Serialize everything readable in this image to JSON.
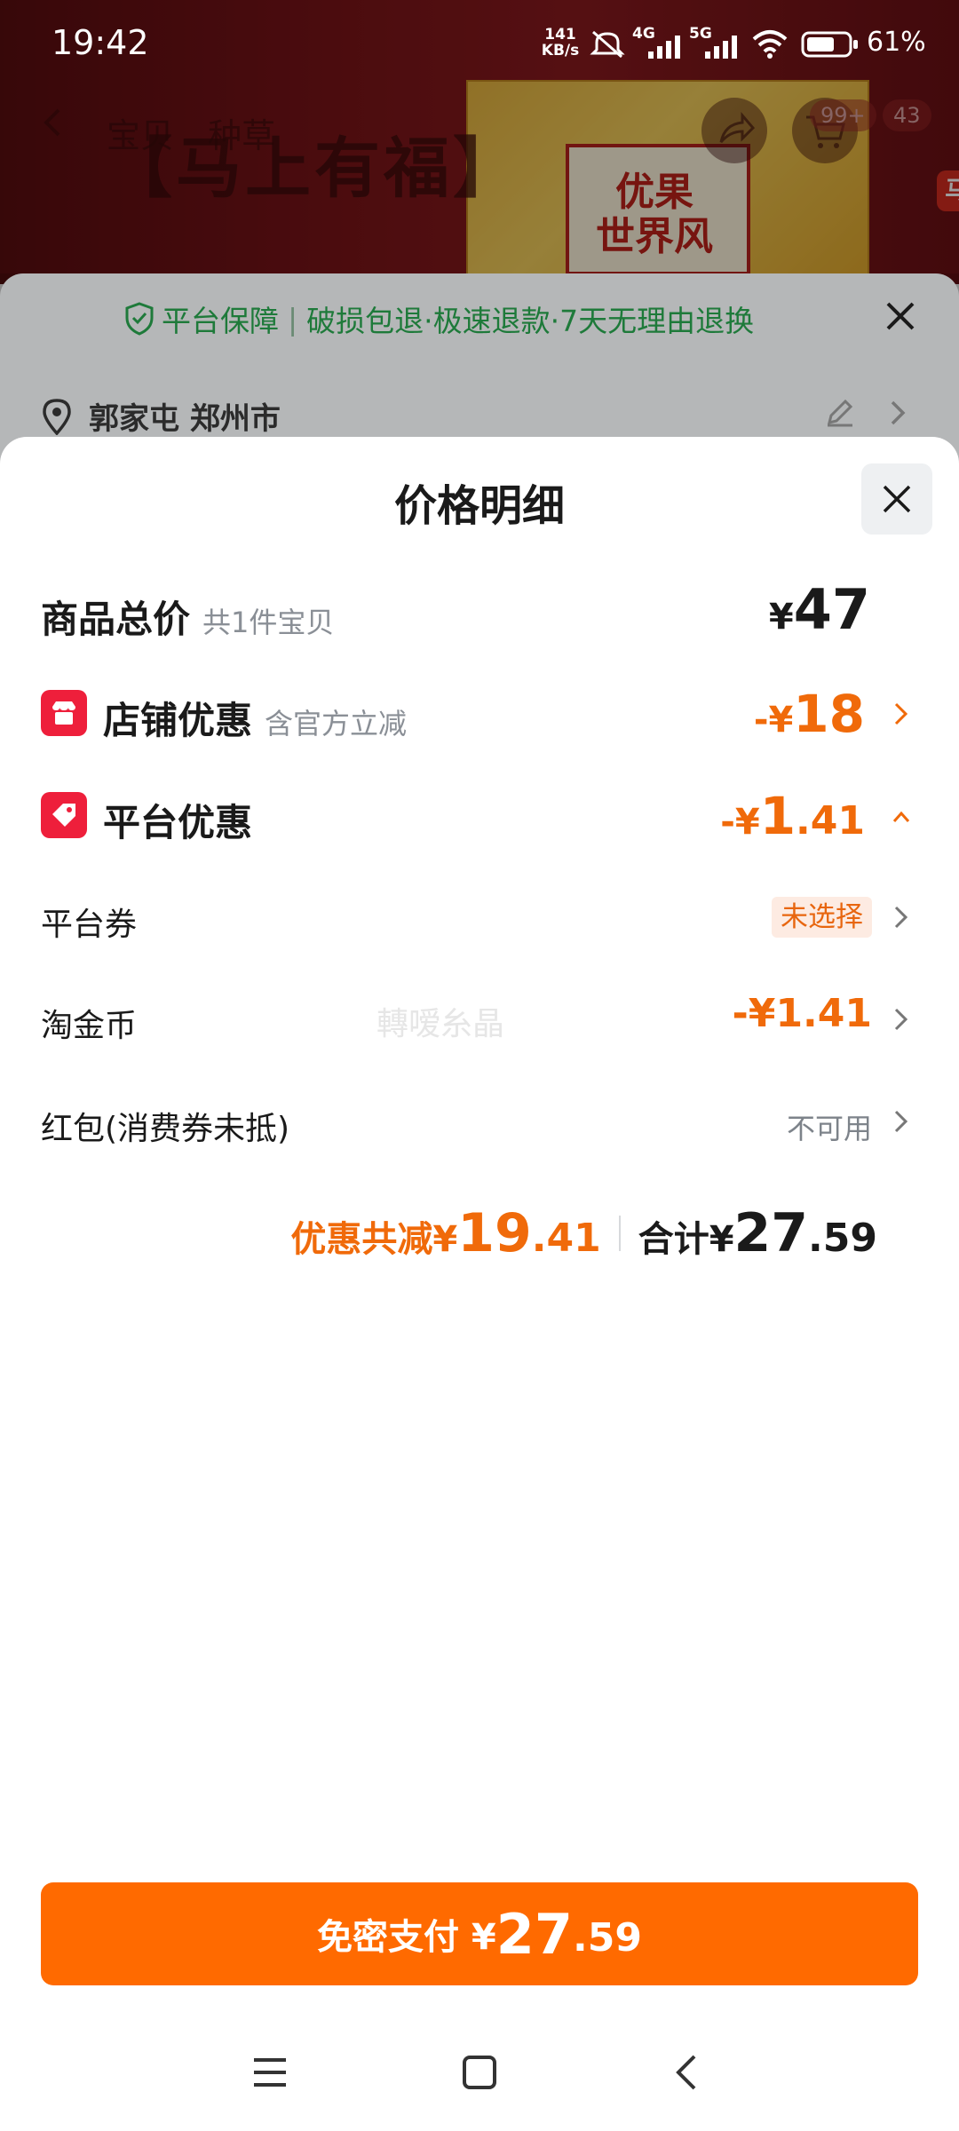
{
  "status_bar": {
    "time": "19:42",
    "speed_value": "141",
    "speed_unit": "KB/s",
    "net1": "4G",
    "net2": "5G",
    "battery": "61%"
  },
  "background": {
    "tab1": "宝贝",
    "tab2": "种草",
    "product_title": "【马上有福】",
    "box_badge": "马",
    "box_text_line1": "优果",
    "box_text_line2": "世界风",
    "cart_count": "99+",
    "extra_count": "43"
  },
  "guarantee": {
    "title": "平台保障",
    "items": "破损包退·极速退款·7天无理由退换"
  },
  "address": {
    "text": "郭家屯 郑州市"
  },
  "sheet": {
    "title": "价格明细"
  },
  "rows": {
    "total_label": "商品总价",
    "total_sub": "共1件宝贝",
    "total_value_sym": "¥",
    "total_value": "47",
    "store_label": "店铺优惠",
    "store_sub": "含官方立减",
    "store_value_sym": "-¥",
    "store_value": "18",
    "platform_label": "平台优惠",
    "platform_value_sym": "-¥",
    "platform_value_int": "1",
    "platform_value_dec": ".41",
    "coupon_label": "平台券",
    "coupon_value": "未选择",
    "coin_label": "淘金币",
    "coin_value_sym": "-¥",
    "coin_value": "1.41",
    "redpacket_label": "红包(消费券未抵)",
    "redpacket_value": "不可用"
  },
  "watermark_text": "轉嗳糸晶",
  "summary": {
    "discount_prefix": "优惠共减¥",
    "discount_int": "19",
    "discount_dec": ".41",
    "total_prefix": "合计¥",
    "total_int": "27",
    "total_dec": ".59"
  },
  "pay_button": {
    "label": "免密支付 ¥",
    "amount_int": "27",
    "amount_dec": ".59"
  },
  "colors": {
    "accent_orange": "#ff6a00",
    "price_orange": "#f06a0a",
    "icon_red": "#ee1f3b",
    "guarantee_green": "#1e7a3a"
  }
}
